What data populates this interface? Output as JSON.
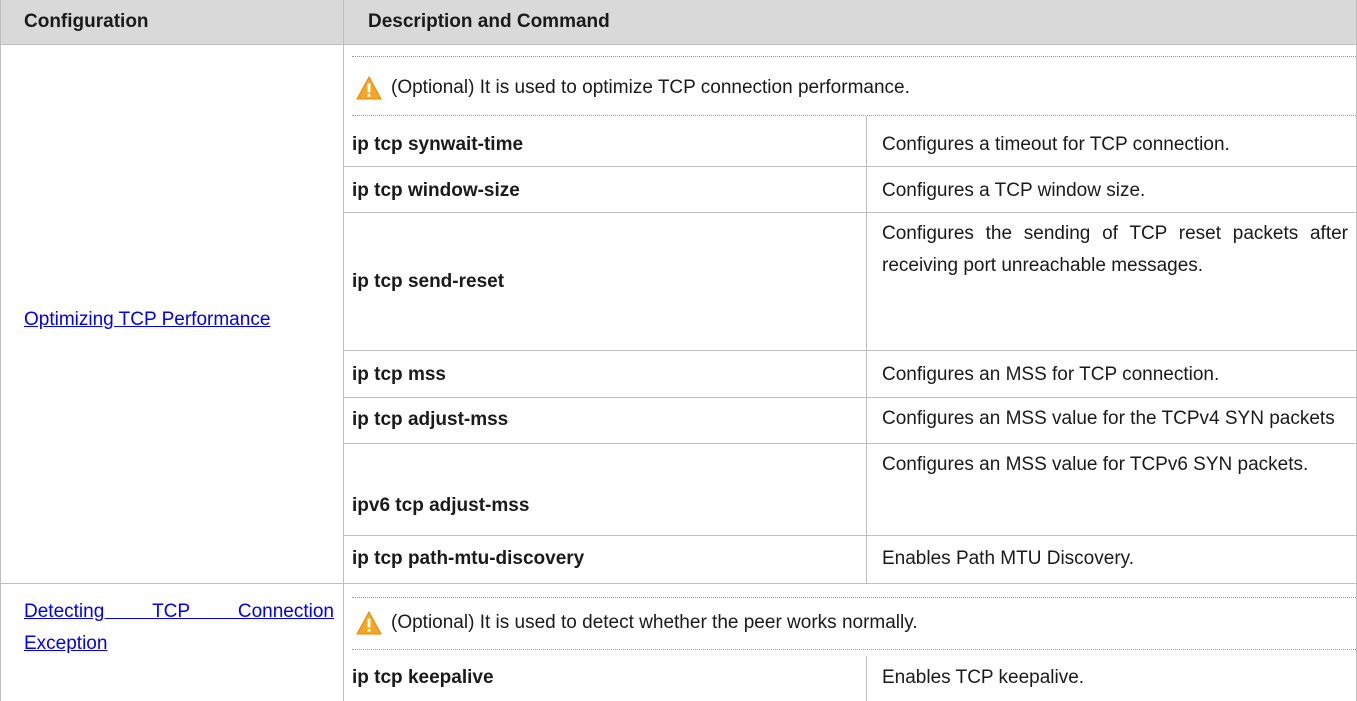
{
  "headers": {
    "configuration": "Configuration",
    "description": "Description and Command"
  },
  "sections": [
    {
      "link": "Optimizing TCP Performance",
      "note": "(Optional) It is used to optimize TCP connection performance.",
      "rows": [
        {
          "command": "ip tcp synwait-time",
          "description": "Configures a timeout for TCP connection."
        },
        {
          "command": "ip tcp window-size",
          "description": "Configures a TCP window size."
        },
        {
          "command": "ip tcp send-reset",
          "description": "Configures the sending of TCP reset packets after receiving port unreachable messages."
        },
        {
          "command": "ip tcp mss",
          "description": "Configures an MSS for TCP connection."
        },
        {
          "command": "ip tcp adjust-mss",
          "description": "Configures an MSS value for the TCPv4 SYN packets"
        },
        {
          "command": "ipv6 tcp adjust-mss",
          "description": "Configures an MSS value for TCPv6 SYN packets."
        },
        {
          "command": "ip tcp path-mtu-discovery",
          "description": "Enables Path MTU Discovery."
        }
      ]
    },
    {
      "link": "Detecting TCP Connection Exception",
      "note": "(Optional) It is used to detect whether the peer works normally.",
      "rows": [
        {
          "command": "ip tcp keepalive",
          "description": "Enables TCP keepalive."
        }
      ]
    }
  ],
  "icons": {
    "warning": "warning-triangle-icon"
  },
  "colors": {
    "header_bg": "#d9d9d9",
    "link": "#0000ee",
    "warning": "#f5a623"
  }
}
